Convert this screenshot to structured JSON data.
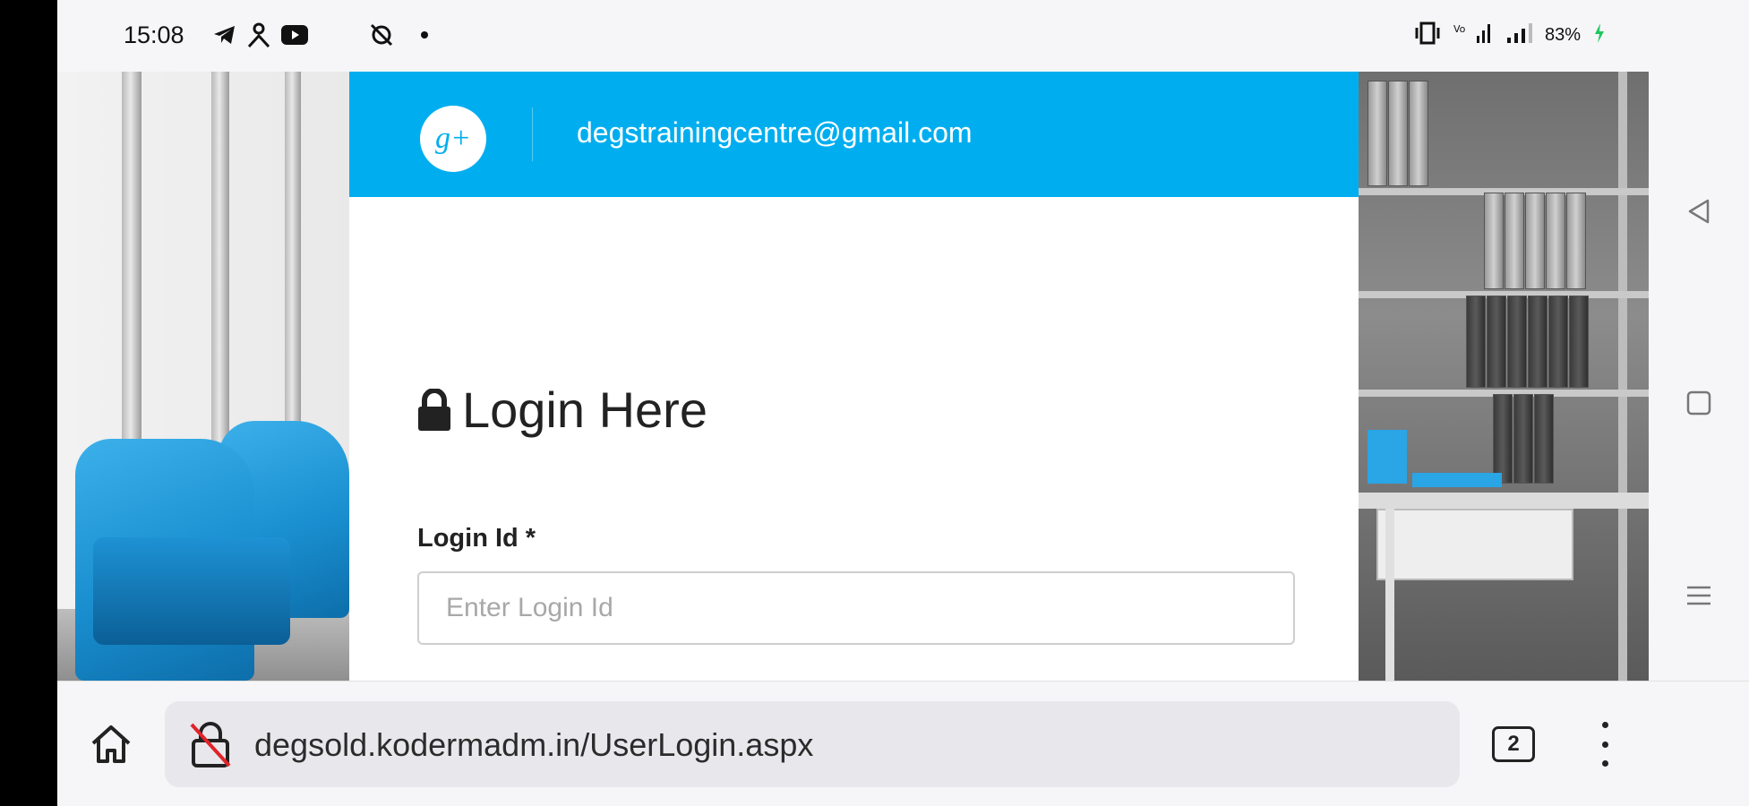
{
  "status_bar": {
    "time": "15:08",
    "battery": "83%",
    "icons_left": [
      "telegram-icon",
      "person-icon",
      "youtube-icon",
      "no-disturb-icon",
      "dot-icon"
    ],
    "icons_right": [
      "vibrate-icon",
      "wifi-icon",
      "signal-icon",
      "battery-charging-icon"
    ]
  },
  "page": {
    "header": {
      "email": "degstrainingcentre@gmail.com",
      "social_icon": "google-plus-icon"
    },
    "login": {
      "title": "Login Here",
      "title_icon": "lock-icon",
      "login_id_label": "Login Id *",
      "login_id_placeholder": "Enter Login Id",
      "login_id_value": ""
    }
  },
  "browser": {
    "url": "degsold.kodermadm.in/UserLogin.aspx",
    "tab_count": "2",
    "home_icon": "home-icon",
    "security_icon": "insecure-lock-icon",
    "menu_icon": "more-vertical-icon"
  },
  "navigation": {
    "buttons": [
      "back-icon",
      "recents-icon",
      "menu-icon"
    ]
  },
  "colors": {
    "header_blue": "#00aeef",
    "chair_blue": "#1a8fd0"
  }
}
